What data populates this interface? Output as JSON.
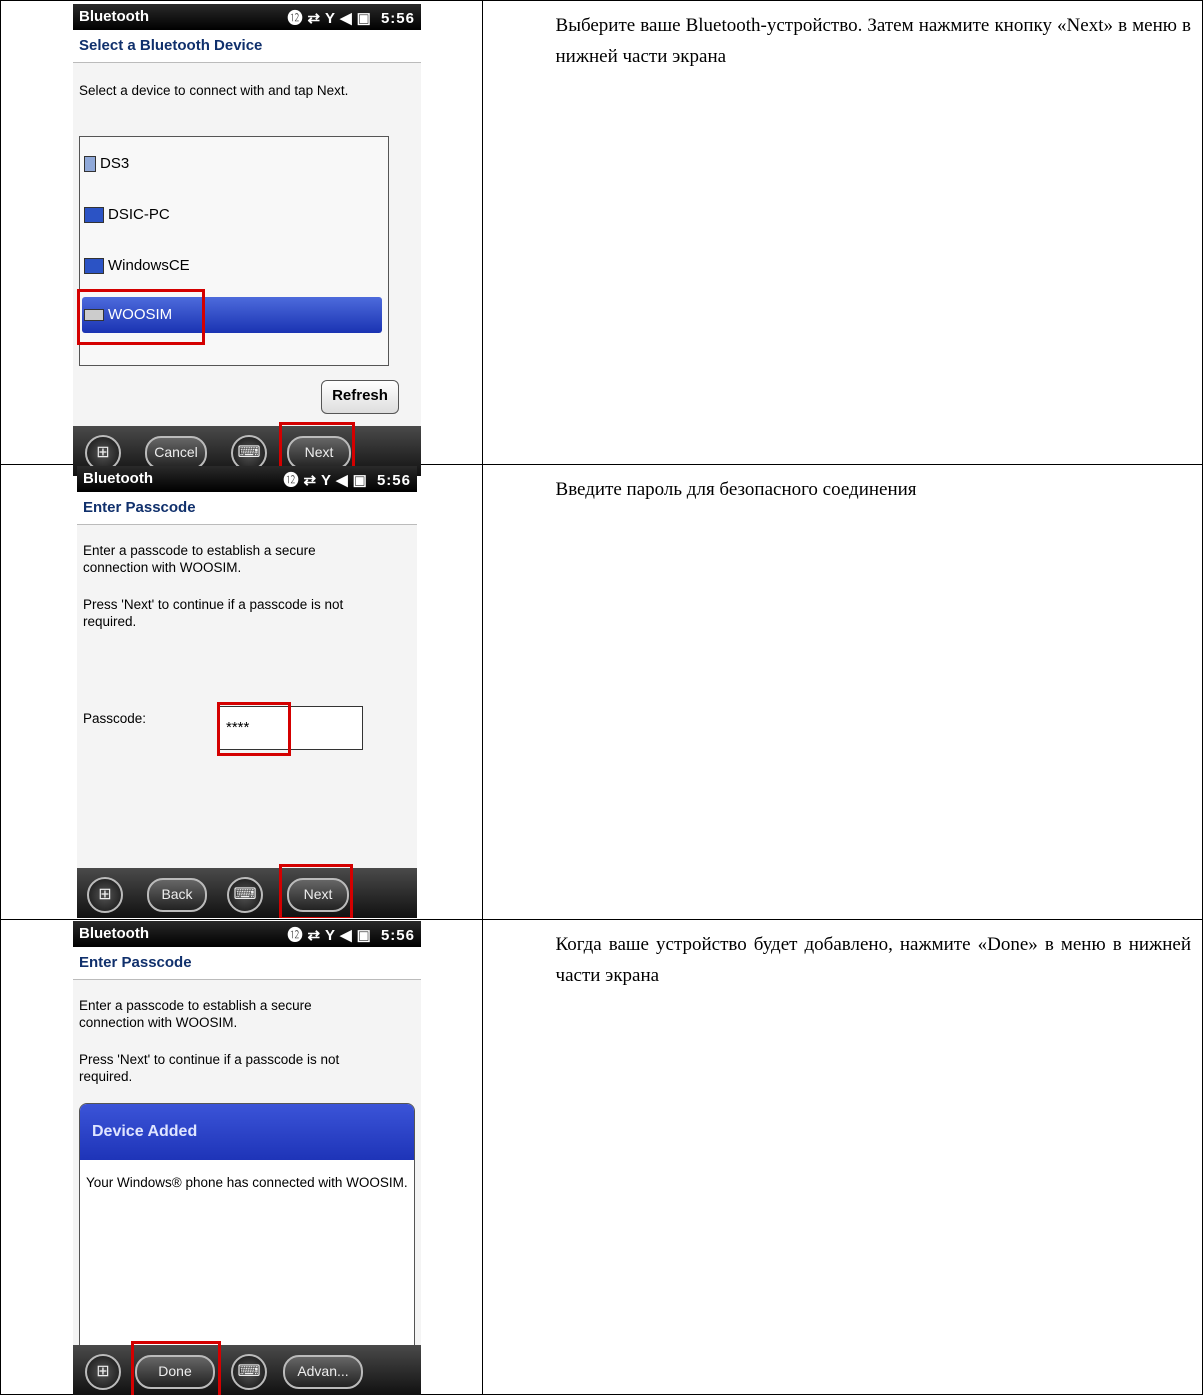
{
  "rows": [
    {
      "status": {
        "app": "Bluetooth",
        "time": "5:56"
      },
      "header": "Select a Bluetooth Device",
      "instruction": "Select a device to connect with and tap Next.",
      "devices": [
        "DS3",
        "DSIC-PC",
        "WindowsCE",
        "WOOSIM"
      ],
      "refresh": "Refresh",
      "softkeys": {
        "left": "Cancel",
        "right": "Next"
      },
      "description": "Выберите ваше Bluetooth-устройство. Затем нажмите кнопку «Next» в меню в нижней части экрана"
    },
    {
      "status": {
        "app": "Bluetooth",
        "time": "5:56"
      },
      "header": "Enter Passcode",
      "p1": "Enter a passcode to establish a secure connection with WOOSIM.",
      "p2": "Press 'Next' to continue if a passcode is not required.",
      "passcode_label": "Passcode:",
      "passcode_value": "****",
      "softkeys": {
        "left": "Back",
        "right": "Next"
      },
      "description": "Введите пароль для безопасного соединения"
    },
    {
      "status": {
        "app": "Bluetooth",
        "time": "5:56"
      },
      "header": "Enter Passcode",
      "p1": "Enter a passcode to establish a secure connection with WOOSIM.",
      "p2": "Press 'Next' to continue if a passcode is not required.",
      "dialog_title": "Device Added",
      "dialog_text": "Your Windows® phone has connected with WOOSIM.",
      "softkeys": {
        "left": "Done",
        "right": "Advan..."
      },
      "description": "Когда ваше устройство будет добавлено, нажмите «Done» в меню в нижней части экрана"
    }
  ]
}
